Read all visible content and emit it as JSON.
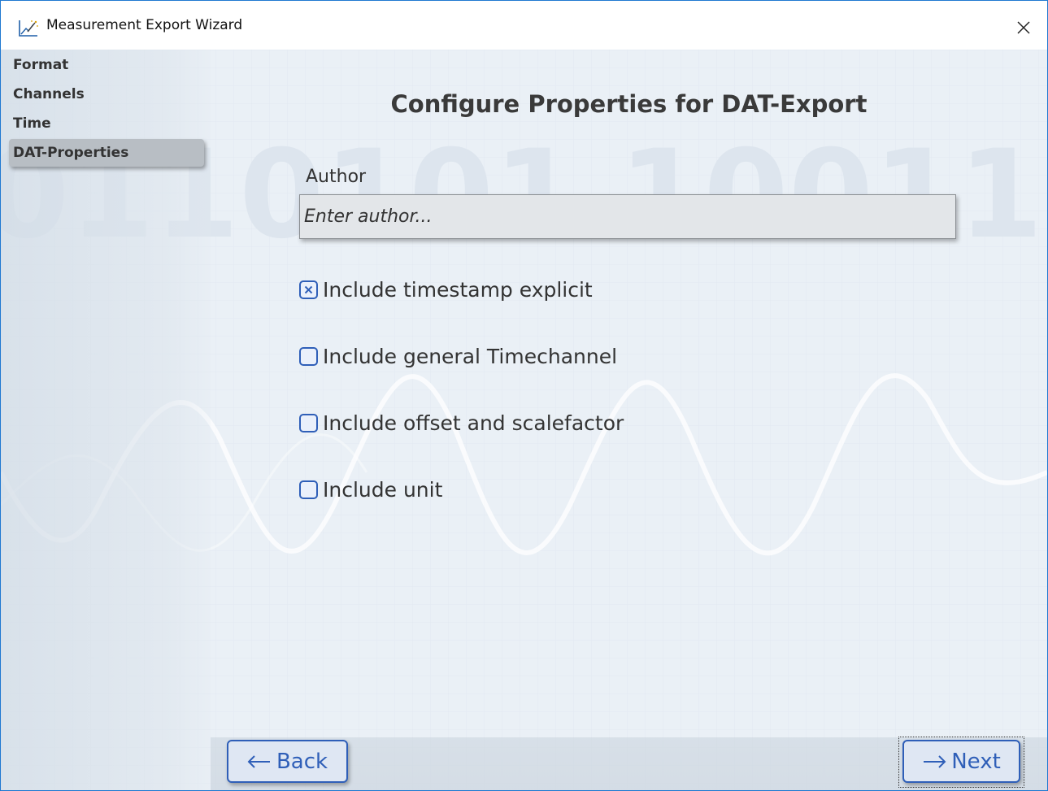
{
  "window": {
    "title": "Measurement Export Wizard",
    "icon": "chart-wand-icon",
    "close_icon": "close-icon"
  },
  "sidebar": {
    "items": [
      {
        "label": "Format",
        "selected": false
      },
      {
        "label": "Channels",
        "selected": false
      },
      {
        "label": "Time",
        "selected": false
      },
      {
        "label": "DAT-Properties",
        "selected": true
      }
    ]
  },
  "main": {
    "heading": "Configure Properties for DAT-Export",
    "author": {
      "label": "Author",
      "value": "",
      "placeholder": "Enter author..."
    },
    "options": [
      {
        "label": "Include timestamp explicit",
        "checked": true
      },
      {
        "label": "Include general Timechannel",
        "checked": false
      },
      {
        "label": "Include offset and scalefactor",
        "checked": false
      },
      {
        "label": "Include unit",
        "checked": false
      }
    ]
  },
  "footer": {
    "back_label": "Back",
    "next_label": "Next",
    "back_icon": "arrow-left-icon",
    "next_icon": "arrow-right-icon"
  },
  "colors": {
    "accent": "#2f5fb8",
    "window_border": "#1f78d1",
    "selected_nav_bg": "#b8bec4",
    "background": "#eef3f8"
  }
}
